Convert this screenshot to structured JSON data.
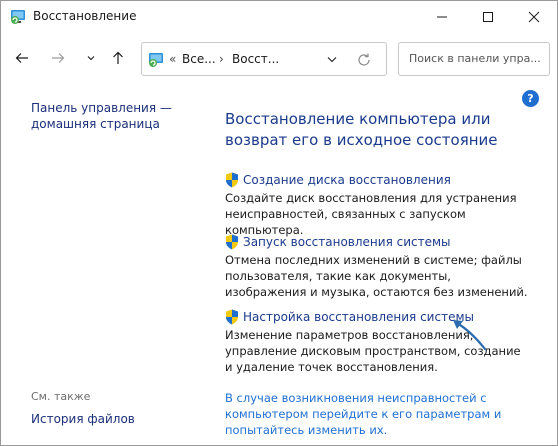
{
  "window": {
    "title": "Восстановление"
  },
  "address": {
    "crumb1": "Все...",
    "crumb2": "Восст..."
  },
  "search": {
    "placeholder": "Поиск в панели упра..."
  },
  "left": {
    "home_link_line1": "Панель управления —",
    "home_link_line2": "домашняя страница",
    "see_also": "См. также",
    "file_history": "История файлов"
  },
  "help": {
    "label": "?"
  },
  "main": {
    "heading": "Восстановление компьютера или возврат его в исходное состояние",
    "tasks": [
      {
        "title": "Создание диска восстановления",
        "desc": "Создайте диск восстановления для устранения неисправностей, связанных с запуском компьютера."
      },
      {
        "title": "Запуск восстановления системы",
        "desc": "Отмена последних изменений в системе; файлы пользователя, такие как документы, изображения и музыка, остаются без изменений."
      },
      {
        "title": "Настройка восстановления системы",
        "desc": "Изменение параметров восстановления, управление дисковым пространством, создание и удаление точек восстановления."
      }
    ],
    "bottom_link": "В случае возникновения неисправностей с компьютером перейдите к его параметрам и попытайтесь изменить их."
  },
  "colors": {
    "link": "#1a3a8c",
    "accent": "#1f6fd1",
    "arrow": "#2b6cb0"
  }
}
